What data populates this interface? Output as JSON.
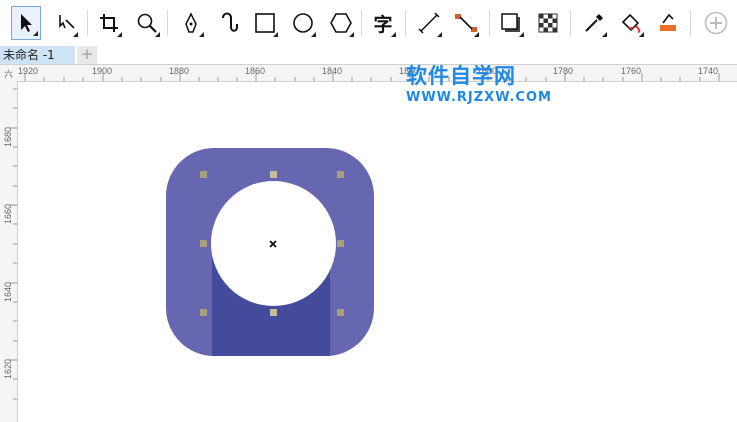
{
  "toolbar": {
    "tools": [
      {
        "icon": "pick-tool-icon",
        "active": true
      },
      {
        "icon": "shape-tool-icon"
      },
      {
        "icon": "crop-tool-icon"
      },
      {
        "icon": "zoom-tool-icon"
      },
      {
        "icon": "pen-tool-icon"
      },
      {
        "icon": "artistic-media-icon"
      },
      {
        "icon": "rectangle-tool-icon"
      },
      {
        "icon": "ellipse-tool-icon"
      },
      {
        "icon": "polygon-tool-icon"
      },
      {
        "icon": "text-tool-icon",
        "label": "字"
      },
      {
        "icon": "dimension-tool-icon"
      },
      {
        "icon": "connector-tool-icon"
      },
      {
        "icon": "drop-shadow-icon"
      },
      {
        "icon": "transparency-icon"
      },
      {
        "icon": "eyedropper-icon"
      },
      {
        "icon": "interactive-fill-icon"
      },
      {
        "icon": "smart-fill-icon"
      },
      {
        "icon": "add-tool-icon"
      }
    ]
  },
  "tabs": {
    "document_name": "未命名 -1",
    "add_label": "+"
  },
  "ruler": {
    "corner_label": "六",
    "horizontal": [
      "1920",
      "1900",
      "1880",
      "1860",
      "1840",
      "1820",
      "1800",
      "1780",
      "1760",
      "1740"
    ],
    "vertical": [
      "1680",
      "1660",
      "1640",
      "1620"
    ]
  },
  "watermark": {
    "title": "软件自学网",
    "url": "WWW.RJZXW.COM"
  },
  "colors": {
    "icon_background": "#6667b0",
    "icon_band": "#444b9b",
    "circle": "#ffffff",
    "watermark": "#1e88e5",
    "handle": "#a7a07a"
  }
}
